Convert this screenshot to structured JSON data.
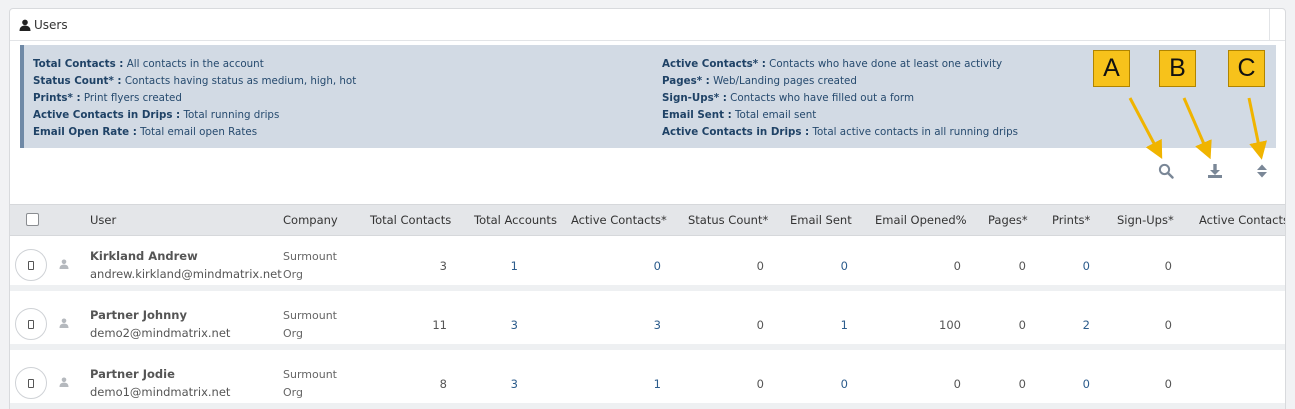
{
  "panel": {
    "title": "Users"
  },
  "legend": {
    "left": [
      {
        "term": "Total Contacts :",
        "desc": "All contacts in the account"
      },
      {
        "term": "Status Count* :",
        "desc": "Contacts having status as medium, high, hot"
      },
      {
        "term": "Prints* :",
        "desc": "Print flyers created"
      },
      {
        "term": "Active Contacts in Drips :",
        "desc": "Total running drips"
      },
      {
        "term": "Email Open Rate :",
        "desc": "Total email open Rates"
      }
    ],
    "right": [
      {
        "term": "Active Contacts* :",
        "desc": "Contacts who have done at least one activity"
      },
      {
        "term": "Pages* :",
        "desc": "Web/Landing pages created"
      },
      {
        "term": "Sign-Ups* :",
        "desc": "Contacts who have filled out a form"
      },
      {
        "term": "Email Sent :",
        "desc": "Total email sent"
      },
      {
        "term": "Active Contacts in Drips :",
        "desc": "Total active contacts in all running drips"
      }
    ]
  },
  "callouts": [
    "A",
    "B",
    "C"
  ],
  "toolbar": {
    "icons": [
      "search-icon",
      "download-icon",
      "sort-icon"
    ]
  },
  "table": {
    "columns": [
      "User",
      "Company",
      "Total Contacts",
      "Total Accounts",
      "Active Contacts*",
      "Status Count*",
      "Email Sent",
      "Email Opened%",
      "Pages*",
      "Prints*",
      "Sign-Ups*",
      "Active Contacts"
    ],
    "rows": [
      {
        "name": "Kirkland Andrew",
        "email": "andrew.kirkland@mindmatrix.net",
        "company": "Surmount Org",
        "total_contacts": "3",
        "total_accounts": "1",
        "active_contacts": "0",
        "status_count": "0",
        "email_sent": "0",
        "email_opened": "0",
        "pages": "0",
        "prints": "0",
        "signups": "0"
      },
      {
        "name": "Partner Johnny",
        "email": "demo2@mindmatrix.net",
        "company": "Surmount Org",
        "total_contacts": "11",
        "total_accounts": "3",
        "active_contacts": "3",
        "status_count": "0",
        "email_sent": "1",
        "email_opened": "100",
        "pages": "0",
        "prints": "2",
        "signups": "0"
      },
      {
        "name": "Partner Jodie",
        "email": "demo1@mindmatrix.net",
        "company": "Surmount Org",
        "total_contacts": "8",
        "total_accounts": "3",
        "active_contacts": "1",
        "status_count": "0",
        "email_sent": "0",
        "email_opened": "0",
        "pages": "0",
        "prints": "0",
        "signups": "0"
      }
    ]
  },
  "colors": {
    "callout": "#f7c21b",
    "legend_bg": "#d2dae4",
    "link": "#2c5c8c",
    "icon": "#7a8797"
  }
}
